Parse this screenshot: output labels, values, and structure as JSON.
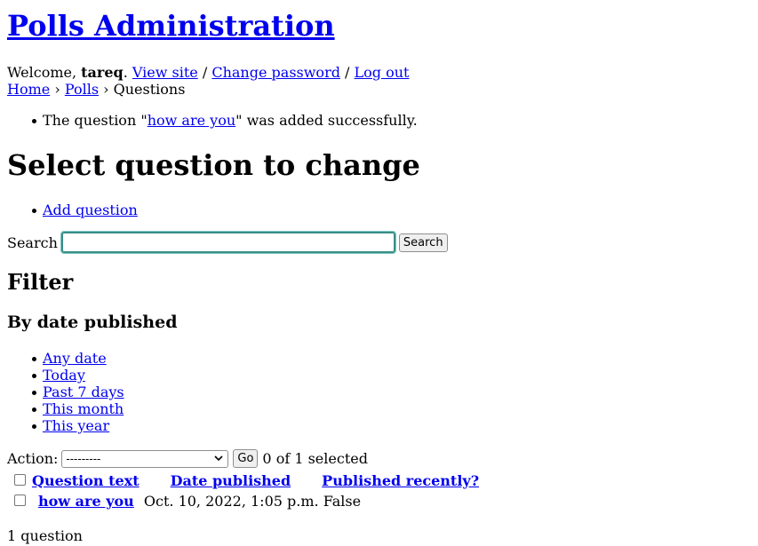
{
  "header": {
    "site_title": "Polls Administration",
    "welcome_prefix": "Welcome, ",
    "username": "tareq",
    "period": ".",
    "view_site": "View site",
    "sep1": "/",
    "change_password": "Change password",
    "sep2": "/",
    "log_out": "Log out"
  },
  "breadcrumb": {
    "home": "Home",
    "sep": "›",
    "polls": "Polls",
    "current": "Questions"
  },
  "messages": {
    "prefix": "The question \"",
    "link": "how are you",
    "suffix": "\" was added successfully."
  },
  "page_title": "Select question to change",
  "object_tools": {
    "add_question": "Add question"
  },
  "search": {
    "label": "Search",
    "value": "",
    "button": "Search"
  },
  "filter": {
    "title": "Filter",
    "subtitle": "By date published",
    "options": [
      "Any date",
      "Today",
      "Past 7 days",
      "This month",
      "This year"
    ]
  },
  "actions": {
    "label": "Action:",
    "selected_value": "---------",
    "go_button": "Go",
    "selection_count": "0 of 1 selected"
  },
  "table": {
    "headers": [
      "Question text",
      "Date published",
      "Published recently?"
    ],
    "rows": [
      {
        "question_text": "how are you",
        "date_published": "Oct. 10, 2022, 1:05 p.m.",
        "published_recently": "False"
      }
    ]
  },
  "paginator": "1 question",
  "icons": {
    "dropdown": "chevron-down-icon"
  }
}
